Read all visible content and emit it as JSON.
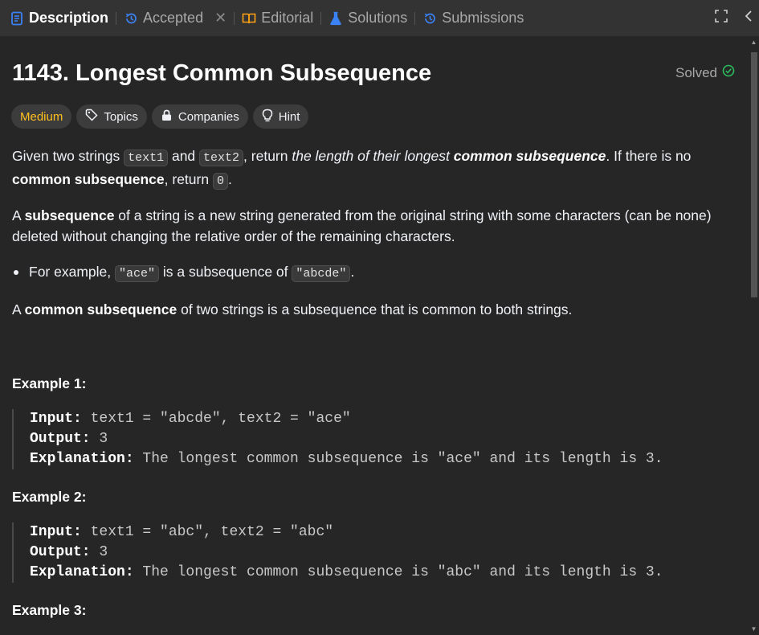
{
  "tabs": [
    {
      "label": "Description",
      "icon": "document-icon"
    },
    {
      "label": "Accepted",
      "icon": "history-icon"
    },
    {
      "label": "Editorial",
      "icon": "book-icon"
    },
    {
      "label": "Solutions",
      "icon": "flask-icon"
    },
    {
      "label": "Submissions",
      "icon": "history-icon"
    }
  ],
  "problem": {
    "title": "1143. Longest Common Subsequence",
    "status": "Solved",
    "difficulty": "Medium",
    "tags": [
      "Topics",
      "Companies",
      "Hint"
    ]
  },
  "description": {
    "p1": {
      "a": "Given two strings ",
      "code1": "text1",
      "b": " and ",
      "code2": "text2",
      "c": ", return ",
      "i1": "the length of their longest ",
      "bi1": "common subsequence",
      "d": ". If there is no ",
      "b1": "common subsequence",
      "e": ", return ",
      "code3": "0",
      "f": "."
    },
    "p2": {
      "a": "A ",
      "b1": "subsequence",
      "c": " of a string is a new string generated from the original string with some characters (can be none) deleted without changing the relative order of the remaining characters."
    },
    "bullet": {
      "a": "For example, ",
      "code1": "\"ace\"",
      "b": " is a subsequence of ",
      "code2": "\"abcde\"",
      "c": "."
    },
    "p3": {
      "a": "A ",
      "b1": "common subsequence",
      "c": " of two strings is a subsequence that is common to both strings."
    }
  },
  "examples": [
    {
      "heading": "Example 1:",
      "input_label": "Input:",
      "input": " text1 = \"abcde\", text2 = \"ace\"",
      "output_label": "Output:",
      "output": " 3",
      "explanation_label": "Explanation:",
      "explanation": " The longest common subsequence is \"ace\" and its length is 3."
    },
    {
      "heading": "Example 2:",
      "input_label": "Input:",
      "input": " text1 = \"abc\", text2 = \"abc\"",
      "output_label": "Output:",
      "output": " 3",
      "explanation_label": "Explanation:",
      "explanation": " The longest common subsequence is \"abc\" and its length is 3."
    },
    {
      "heading": "Example 3:"
    }
  ],
  "colors": {
    "background": "#262626",
    "tabbar": "#333333",
    "medium": "#ffc01e",
    "solved_check": "#2cbb5d",
    "description_tab_icon": "#3b82f6",
    "history_icon": "#3b82f6",
    "editorial_icon": "#ffa116",
    "solutions_icon": "#3b82f6"
  }
}
